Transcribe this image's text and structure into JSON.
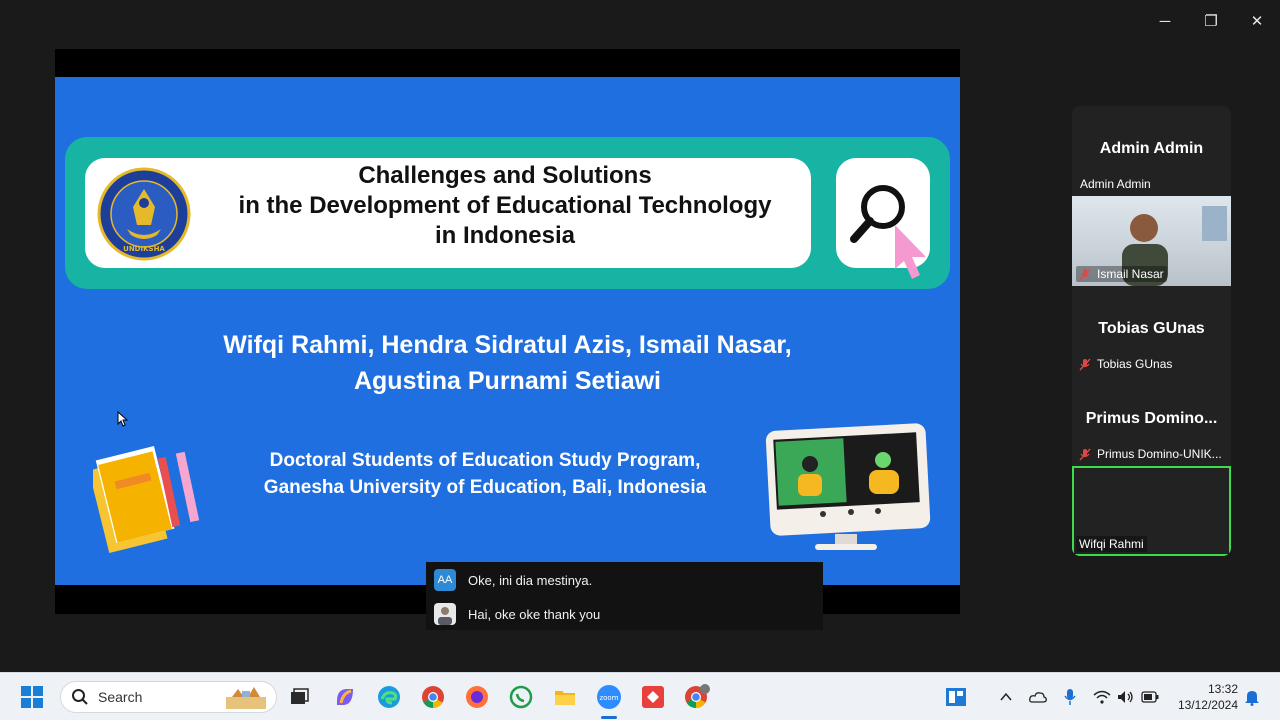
{
  "window": {
    "minimize_glyph": "─",
    "restore_glyph": "❐",
    "close_glyph": "✕"
  },
  "slide": {
    "title_lines": [
      "Challenges and Solutions",
      "in the Development of  Educational Technology",
      "in Indonesia"
    ],
    "authors_lines": [
      "Wifqi Rahmi, Hendra Sidratul Azis,  Ismail Nasar,",
      "Agustina Purnami Setiawi"
    ],
    "affiliation_lines": [
      "Doctoral Students of  Education Study Program,",
      "Ganesha University of Education, Bali, Indonesia"
    ],
    "logo_text": "UNDIKSHA",
    "colors": {
      "background": "#1f6fe0",
      "band": "#17b3a3",
      "card": "#ffffff"
    }
  },
  "chat": {
    "messages": [
      {
        "avatar": "AA",
        "text": "Oke, ini dia mestinya."
      },
      {
        "avatar": "",
        "text": "Hai, oke oke thank you"
      }
    ]
  },
  "participants": [
    {
      "big_name": "Admin Admin",
      "label": "Admin Admin",
      "muted": false,
      "video": false
    },
    {
      "big_name": "",
      "label": "Ismail Nasar",
      "muted": true,
      "video": true
    },
    {
      "big_name": "Tobias GUnas",
      "label": "Tobias GUnas",
      "muted": true,
      "video": false
    },
    {
      "big_name": "Primus  Domino...",
      "label": "Primus Domino-UNIK...",
      "muted": true,
      "video": false
    },
    {
      "big_name": "",
      "label": "Wifqi Rahmi",
      "muted": false,
      "video": true,
      "active_speaker": true
    }
  ],
  "taskbar": {
    "search_label": "Search",
    "time": "13:32",
    "date": "13/12/2024",
    "icons": [
      "windows-start-icon",
      "search-icon",
      "task-view-icon",
      "copilot-icon",
      "edge-icon",
      "chrome-icon",
      "firefox-icon",
      "whatsapp-icon",
      "file-explorer-icon",
      "zoom-icon",
      "anydesk-icon",
      "chrome-profile-icon",
      "widgets-icon",
      "chevron-up-icon",
      "onedrive-icon",
      "microphone-icon",
      "wifi-icon",
      "volume-icon",
      "battery-icon",
      "notification-bell-icon"
    ],
    "active_app": "zoom-icon"
  }
}
